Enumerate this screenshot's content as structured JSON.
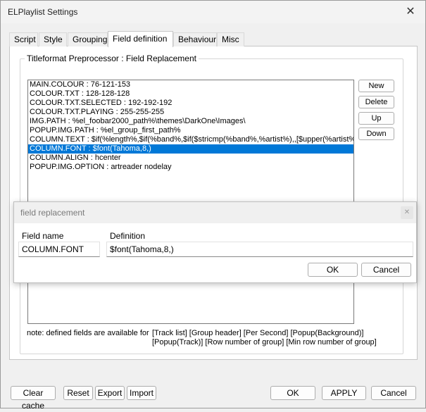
{
  "window": {
    "title": "ELPlaylist Settings"
  },
  "tabs": [
    {
      "label": "Script",
      "active": false
    },
    {
      "label": "Style",
      "active": false
    },
    {
      "label": "Grouping",
      "active": false
    },
    {
      "label": "Field definition",
      "active": true
    },
    {
      "label": "Behaviour",
      "active": false
    },
    {
      "label": "Misc",
      "active": false
    }
  ],
  "group": {
    "label": "Titleformat Preprocessor : Field Replacement"
  },
  "list": {
    "selected_index": 7,
    "items": [
      "MAIN.COLOUR : 76-121-153",
      "COLOUR.TXT : 128-128-128",
      "COLOUR.TXT.SELECTED : 192-192-192",
      "COLOUR.TXT.PLAYING : 255-255-255",
      "IMG.PATH : %el_foobar2000_path%\\themes\\DarkOne\\Images\\",
      "POPUP.IMG.PATH : %el_group_first_path%",
      "COLUMN.TEXT : $if(%length%,$if(%band%,$if($stricmp(%band%,%artist%),,[$upper(%artist%)",
      "COLUMN.FONT : $font(Tahoma,8,)",
      "COLUMN.ALIGN : hcenter",
      "POPUP.IMG.OPTION : artreader nodelay"
    ]
  },
  "side_buttons": {
    "new": "New",
    "delete": "Delete",
    "up": "Up",
    "down": "Down"
  },
  "note": {
    "label": "note: defined fields are available for",
    "line1": "[Track list]  [Group header]  [Per Second]  [Popup(Background)]",
    "line2": "[Popup(Track)]  [Row number of group]  [Min row number of group]"
  },
  "bottom": {
    "clear_cache": "Clear cache",
    "reset": "Reset",
    "export": "Export",
    "import": "Import",
    "ok": "OK",
    "apply": "APPLY",
    "cancel": "Cancel"
  },
  "dialog": {
    "title": "field replacement",
    "field_name_label": "Field name",
    "definition_label": "Definition",
    "field_name_value": "COLUMN.FONT",
    "definition_value": "$font(Tahoma,8,)",
    "ok": "OK",
    "cancel": "Cancel"
  },
  "colors": {
    "selection": "#0078d7"
  }
}
